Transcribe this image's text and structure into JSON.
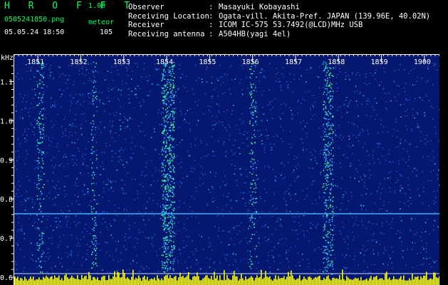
{
  "header": {
    "app_logo": "H R O F F T",
    "version": "1.00",
    "filename": "0505241850.png",
    "mode_label": "meteor",
    "datetime": "05.05.24 18:50",
    "meteor_count": "105"
  },
  "info": [
    {
      "key": "Observer",
      "colon": ":",
      "value": "Masayuki Kobayashi"
    },
    {
      "key": "Receiving Location",
      "colon": ":",
      "value": "Ogata-vill. Akita-Pref. JAPAN (139.96E, 40.02N)"
    },
    {
      "key": "Receiver",
      "colon": ":",
      "value": "ICOM IC-575 53.7492(@LCD)MHz USB"
    },
    {
      "key": "Receiving antenna",
      "colon": ":",
      "value": "A504HB(yagi 4el)"
    }
  ],
  "spectrogram": {
    "y_unit": "kHz",
    "y_ticks": [
      "1.1",
      "1.0",
      "0.9",
      "0.8",
      "0.7",
      "0.6"
    ],
    "y_tick_values": [
      1.1,
      1.0,
      0.9,
      0.8,
      0.7,
      0.6
    ],
    "y_range": [
      0.58,
      1.17
    ],
    "time_labels": [
      "1851",
      "1852",
      "1853",
      "1854",
      "1855",
      "1856",
      "1857",
      "1858",
      "1859",
      "1900"
    ],
    "time_values": [
      1,
      2,
      3,
      4,
      5,
      6,
      7,
      8,
      9,
      10
    ],
    "x_range": [
      0.45,
      10.35
    ],
    "carrier_khz": 0.762,
    "colors": {
      "background": "#041870",
      "noise_low": "#1d57d6",
      "noise_high": "#35b6ff",
      "echo": "#39ff8a",
      "carrier": "#3ab0ff",
      "ticks": "#ffffff",
      "level_bars": "#ffff00",
      "logo": "#00ff66"
    }
  }
}
